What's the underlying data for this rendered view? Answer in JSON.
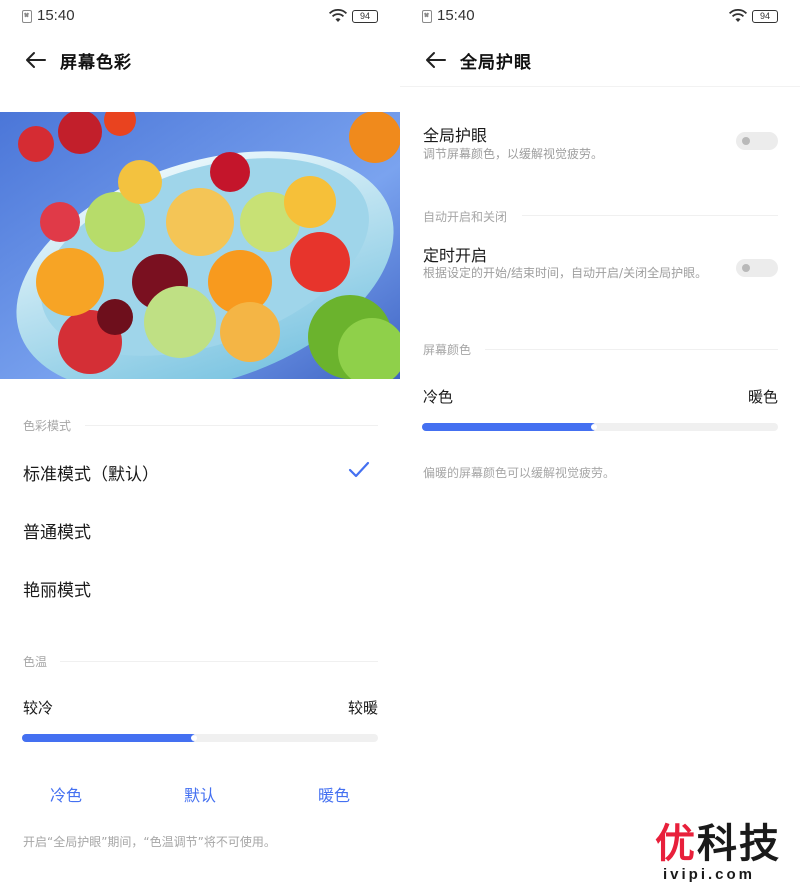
{
  "status_bar": {
    "time": "15:40",
    "battery": "94"
  },
  "left": {
    "title": "屏幕色彩",
    "color_mode_section": "色彩模式",
    "modes": [
      {
        "label": "标准模式（默认）",
        "selected": true
      },
      {
        "label": "普通模式",
        "selected": false
      },
      {
        "label": "艳丽模式",
        "selected": false
      }
    ],
    "color_temp_section": "色温",
    "slider": {
      "left_label": "较冷",
      "right_label": "较暖",
      "value": 0.49
    },
    "presets": [
      "冷色",
      "默认",
      "暖色"
    ],
    "footer_note": "开启“全局护眼”期间，“色温调节”将不可使用。"
  },
  "right": {
    "title": "全局护眼",
    "global_eye_care": {
      "title": "全局护眼",
      "desc": "调节屏幕颜色，以缓解视觉疲劳。",
      "enabled": false
    },
    "auto_section": "自动开启和关闭",
    "schedule": {
      "title": "定时开启",
      "desc": "根据设定的开始/结束时间，自动开启/关闭全局护眼。",
      "enabled": false
    },
    "screen_color_section": "屏幕颜色",
    "slider": {
      "left_label": "冷色",
      "right_label": "暖色",
      "value": 0.49
    },
    "note": "偏暖的屏幕颜色可以缓解视觉疲劳。"
  },
  "watermark": {
    "logo": "优科技",
    "url": "ivipi.com"
  },
  "colors": {
    "accent": "#4470f1",
    "watermark_red": "#e8203b"
  },
  "icons": [
    "back-arrow-icon",
    "check-icon",
    "wifi-icon",
    "battery-icon",
    "app-notification-icon"
  ]
}
